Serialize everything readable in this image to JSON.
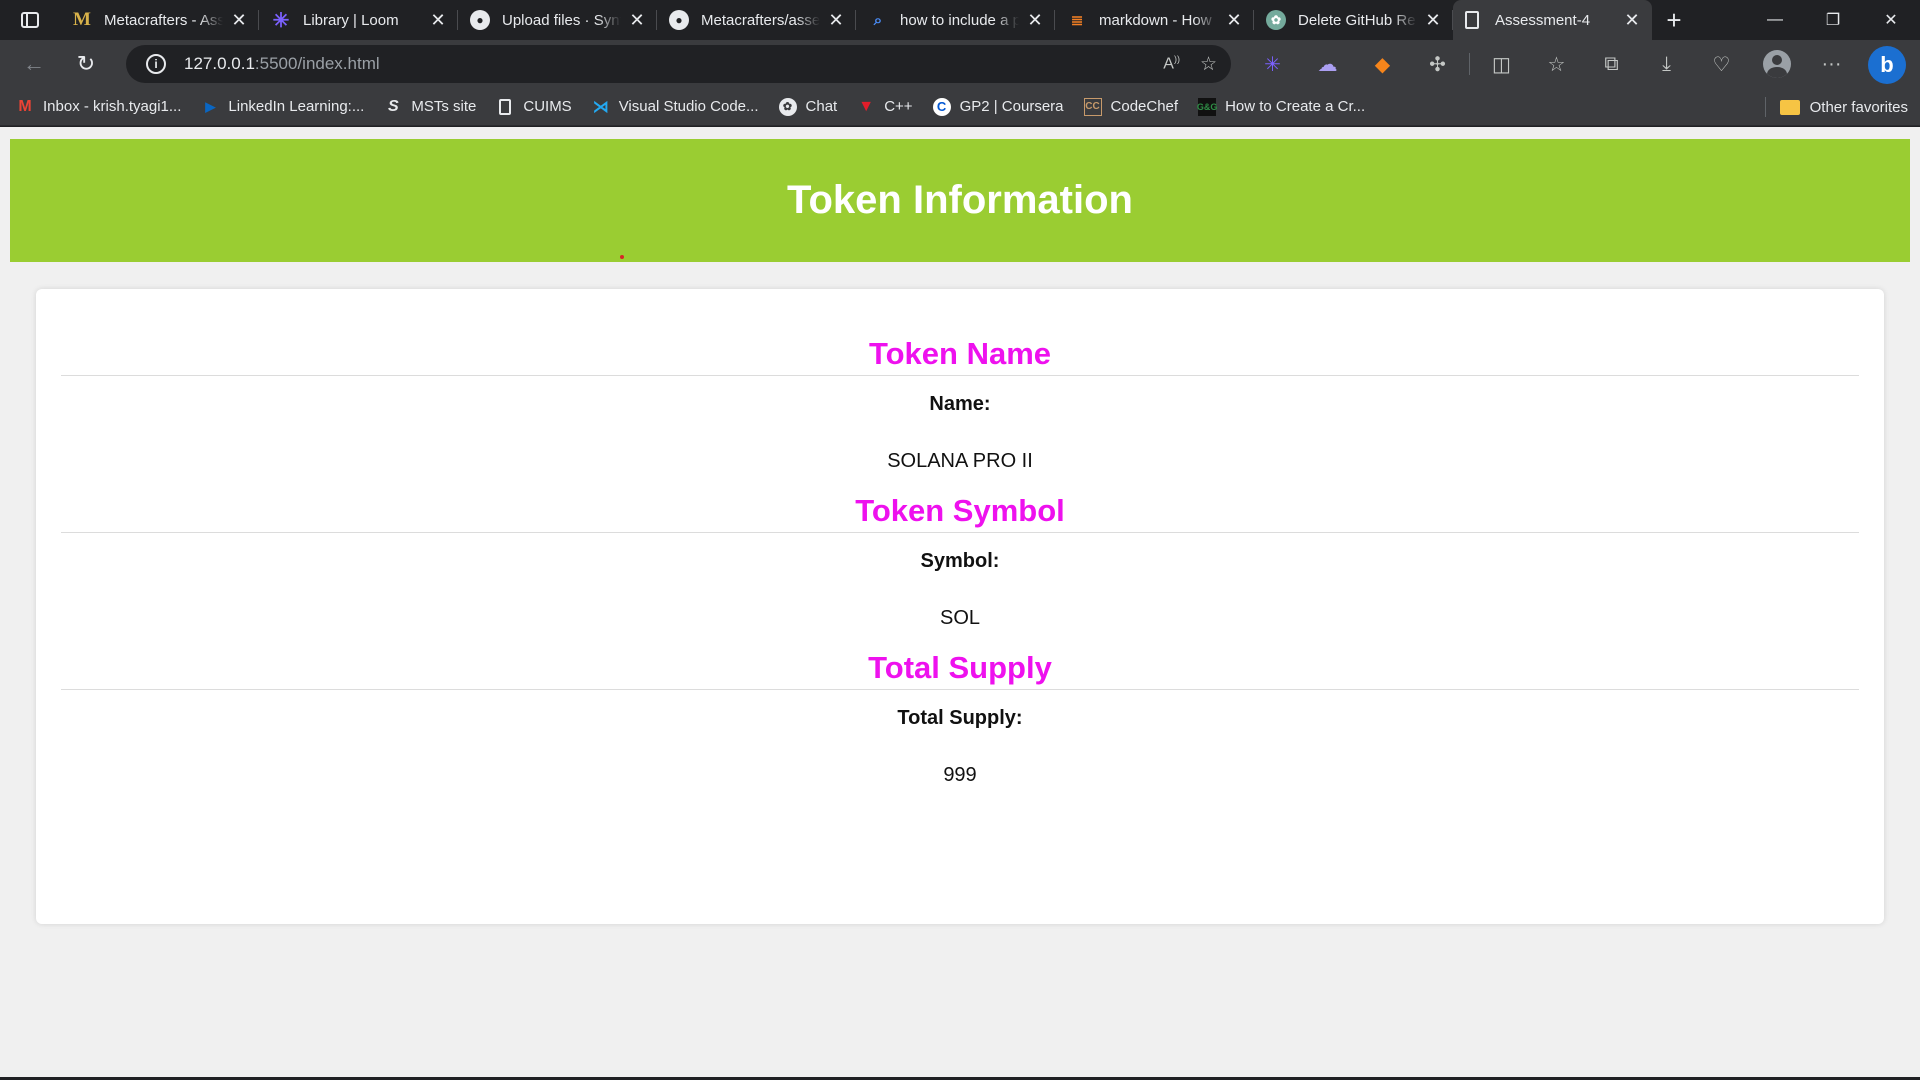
{
  "browser": {
    "tabs": [
      {
        "title": "Metacrafters - Assessment",
        "icon": "metacrafters-icon",
        "active": false
      },
      {
        "title": "Library | Loom",
        "icon": "loom-icon",
        "active": false
      },
      {
        "title": "Upload files · Synt",
        "icon": "github-icon",
        "active": false
      },
      {
        "title": "Metacrafters/asse",
        "icon": "github-icon",
        "active": false
      },
      {
        "title": "how to include a p",
        "icon": "search-icon",
        "active": false
      },
      {
        "title": "markdown - How",
        "icon": "stackoverflow-icon",
        "active": false
      },
      {
        "title": "Delete GitHub Re",
        "icon": "chatgpt-icon",
        "active": false
      },
      {
        "title": "Assessment-4",
        "icon": "page-icon",
        "active": true
      }
    ],
    "address": {
      "host": "127.0.0.1",
      "rest": ":5500/index.html"
    },
    "bookmarks": [
      {
        "label": "Inbox - krish.tyagi1...",
        "icon": "gmail-icon"
      },
      {
        "label": "LinkedIn Learning:...",
        "icon": "linkedin-learning-icon"
      },
      {
        "label": "MSTs site",
        "icon": "s-icon"
      },
      {
        "label": "CUIMS",
        "icon": "page-icon"
      },
      {
        "label": "Visual Studio Code...",
        "icon": "vscode-icon"
      },
      {
        "label": "Chat",
        "icon": "chatgpt-icon"
      },
      {
        "label": "C++",
        "icon": "cpp-icon"
      },
      {
        "label": "GP2 | Coursera",
        "icon": "coursera-icon"
      },
      {
        "label": "CodeChef",
        "icon": "codechef-icon"
      },
      {
        "label": "How to Create a Cr...",
        "icon": "gfg-icon"
      }
    ],
    "other_favorites": "Other favorites"
  },
  "page": {
    "header_title": "Token Information",
    "sections": [
      {
        "heading": "Token Name",
        "label": "Name:",
        "value": "SOLANA PRO II"
      },
      {
        "heading": "Token Symbol",
        "label": "Symbol:",
        "value": "SOL"
      },
      {
        "heading": "Total Supply",
        "label": "Total Supply:",
        "value": "999"
      }
    ]
  },
  "colors": {
    "banner": "#9acd32",
    "heading": "#ee11ee",
    "page_bg": "#f0f0f0"
  }
}
